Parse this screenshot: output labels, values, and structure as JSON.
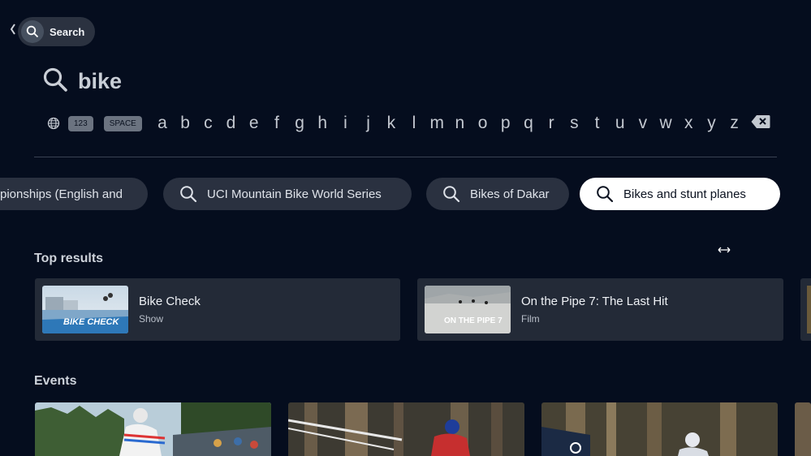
{
  "header": {
    "search_label": "Search",
    "back_icon": "chevron-left-icon"
  },
  "query": {
    "text": "bike"
  },
  "keyboard": {
    "globe_icon": "globe-icon",
    "numbers_label": "123",
    "space_label": "SPACE",
    "letters": [
      "a",
      "b",
      "c",
      "d",
      "e",
      "f",
      "g",
      "h",
      "i",
      "j",
      "k",
      "l",
      "m",
      "n",
      "o",
      "p",
      "q",
      "r",
      "s",
      "t",
      "u",
      "v",
      "w",
      "x",
      "y",
      "z"
    ],
    "backspace_icon": "backspace-icon"
  },
  "suggestions": [
    {
      "label": "pionships (English and",
      "active": false
    },
    {
      "label": "UCI Mountain Bike World Series",
      "active": false
    },
    {
      "label": "Bikes of Dakar",
      "active": false
    },
    {
      "label": "Bikes and stunt planes",
      "active": true
    }
  ],
  "top_results": {
    "title": "Top results",
    "items": [
      {
        "title": "Bike Check",
        "type": "Show",
        "thumb_text": "BIKE CHECK"
      },
      {
        "title": "On the Pipe 7: The Last Hit",
        "type": "Film",
        "thumb_text": "ON THE PIPE 7"
      }
    ]
  },
  "events": {
    "title": "Events"
  },
  "colors": {
    "background": "#050d1e",
    "chip": "#2a3140",
    "chip_active": "#ffffff",
    "card": "#232a37"
  }
}
